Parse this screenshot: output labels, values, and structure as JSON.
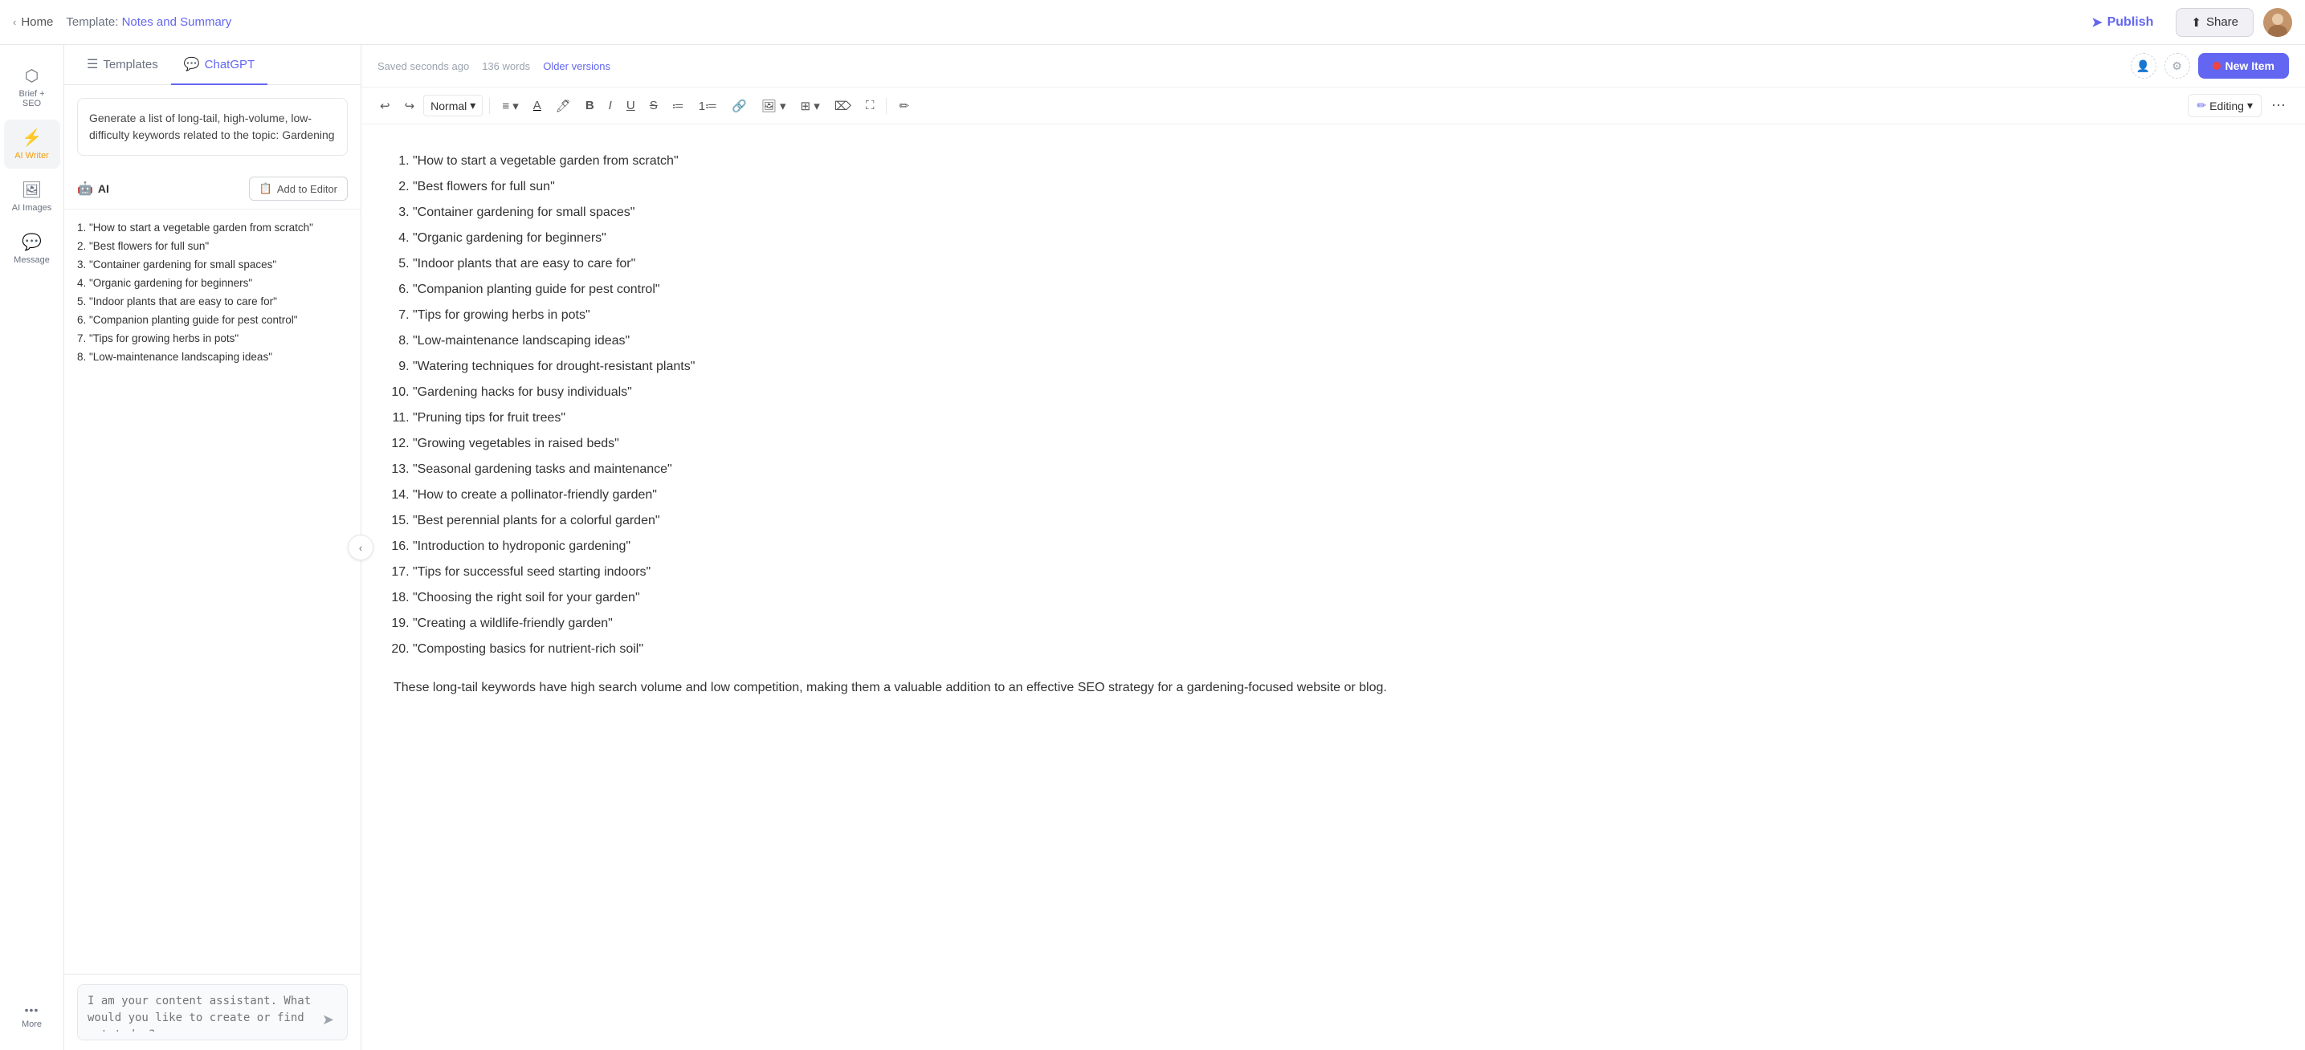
{
  "topbar": {
    "home_label": "Home",
    "breadcrumb_prefix": "Template:",
    "breadcrumb_name": "Notes and Summary",
    "publish_label": "Publish",
    "share_label": "Share"
  },
  "sidebar": {
    "items": [
      {
        "id": "brief-seo",
        "icon": "⬡",
        "label": "Brief + SEO"
      },
      {
        "id": "ai-writer",
        "icon": "⚡",
        "label": "AI Writer"
      },
      {
        "id": "ai-images",
        "icon": "🖼",
        "label": "AI Images"
      },
      {
        "id": "message",
        "icon": "💬",
        "label": "Message"
      },
      {
        "id": "more",
        "icon": "•••",
        "label": "More"
      }
    ]
  },
  "panel": {
    "tabs": [
      {
        "id": "templates",
        "icon": "☰",
        "label": "Templates"
      },
      {
        "id": "chatgpt",
        "icon": "💬",
        "label": "ChatGPT",
        "active": true
      }
    ],
    "prompt": "Generate a list of long-tail, high-volume, low-difficulty keywords related to the topic: Gardening",
    "ai_label": "AI",
    "add_to_editor_label": "Add to Editor",
    "response_items": [
      "1. \"How to start a vegetable garden from scratch\"",
      "2. \"Best flowers for full sun\"",
      "3. \"Container gardening for small spaces\"",
      "4. \"Organic gardening for beginners\"",
      "5. \"Indoor plants that are easy to care for\"",
      "6. \"Companion planting guide for pest control\"",
      "7. \"Tips for growing herbs in pots\"",
      "8. \"Low-maintenance landscaping ideas\""
    ],
    "chat_placeholder": "I am your content assistant. What would you like to create or find out today?"
  },
  "editor": {
    "saved_status": "Saved seconds ago",
    "word_count": "136 words",
    "older_versions": "Older versions",
    "new_item_label": "New Item",
    "style_dropdown": "Normal",
    "editing_label": "Editing",
    "content_items": [
      "\"How to start a vegetable garden from scratch\"",
      "\"Best flowers for full sun\"",
      "\"Container gardening for small spaces\"",
      "\"Organic gardening for beginners\"",
      "\"Indoor plants that are easy to care for\"",
      "\"Companion planting guide for pest control\"",
      "\"Tips for growing herbs in pots\"",
      "\"Low-maintenance landscaping ideas\"",
      "\"Watering techniques for drought-resistant plants\"",
      "\"Gardening hacks for busy individuals\"",
      "\"Pruning tips for fruit trees\"",
      "\"Growing vegetables in raised beds\"",
      "\"Seasonal gardening tasks and maintenance\"",
      "\"How to create a pollinator-friendly garden\"",
      "\"Best perennial plants for a colorful garden\"",
      "\"Introduction to hydroponic gardening\"",
      "\"Tips for successful seed starting indoors\"",
      "\"Choosing the right soil for your garden\"",
      "\"Creating a wildlife-friendly garden\"",
      "\"Composting basics for nutrient-rich soil\""
    ],
    "footer_text": "These long-tail keywords have high search volume and low competition, making them a valuable addition to an effective SEO strategy for a gardening-focused website or blog."
  }
}
